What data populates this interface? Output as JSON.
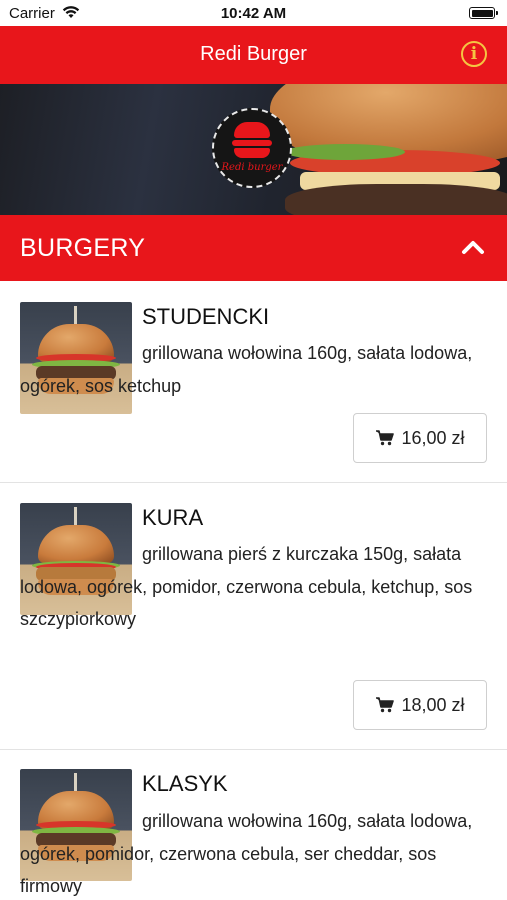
{
  "status_bar": {
    "carrier": "Carrier",
    "time": "10:42 AM"
  },
  "header": {
    "title": "Redi Burger",
    "info_icon": "info-icon",
    "accent_color": "#e8161b",
    "info_color": "#f5c542"
  },
  "hero": {
    "logo_text": "Redi burger"
  },
  "category": {
    "title": "BURGERY",
    "icon": "chevron-up-icon"
  },
  "items": [
    {
      "name": "STUDENCKI",
      "description": "grillowana wołowina 160g, sałata lodowa, ogórek, sos ketchup",
      "price": "16,00 zł"
    },
    {
      "name": "KURA",
      "description": "grillowana pierś z kurczaka 150g, sałata lodowa, ogórek, pomidor, czerwona cebula, ketchup, sos szczypiorkowy",
      "price": "18,00 zł"
    },
    {
      "name": "KLASYK",
      "description": "grillowana wołowina 160g, sałata lodowa, ogórek, pomidor, czerwona cebula, ser cheddar, sos firmowy"
    }
  ]
}
